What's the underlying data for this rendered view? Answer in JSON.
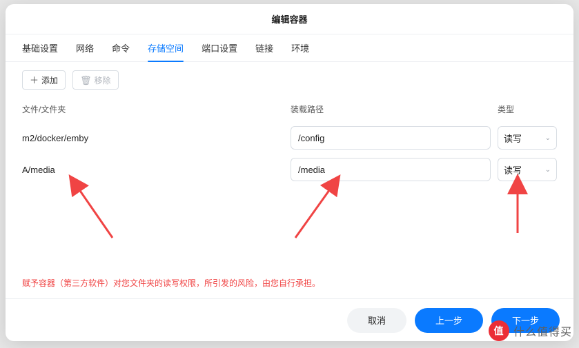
{
  "title": "编辑容器",
  "tabs": [
    {
      "key": "basic",
      "label": "基础设置"
    },
    {
      "key": "network",
      "label": "网络"
    },
    {
      "key": "cmd",
      "label": "命令"
    },
    {
      "key": "storage",
      "label": "存储空间",
      "active": true
    },
    {
      "key": "port",
      "label": "端口设置"
    },
    {
      "key": "link",
      "label": "链接"
    },
    {
      "key": "env",
      "label": "环境"
    }
  ],
  "toolbar": {
    "add_label": "添加",
    "remove_label": "移除"
  },
  "columns": {
    "c1": "文件/文件夹",
    "c2": "装载路径",
    "c3": "类型"
  },
  "rows": [
    {
      "host": "m2/docker/emby",
      "mount": "/config",
      "mode": "读写"
    },
    {
      "host": "A/media",
      "mount": "/media",
      "mode": "读写"
    }
  ],
  "warning": "赋予容器（第三方软件）对您文件夹的读写权限，所引发的风险，由您自行承担。",
  "footer": {
    "cancel": "取消",
    "prev": "上一步",
    "next": "下一步"
  },
  "watermark": {
    "logo": "值",
    "text": "什么值得买"
  }
}
